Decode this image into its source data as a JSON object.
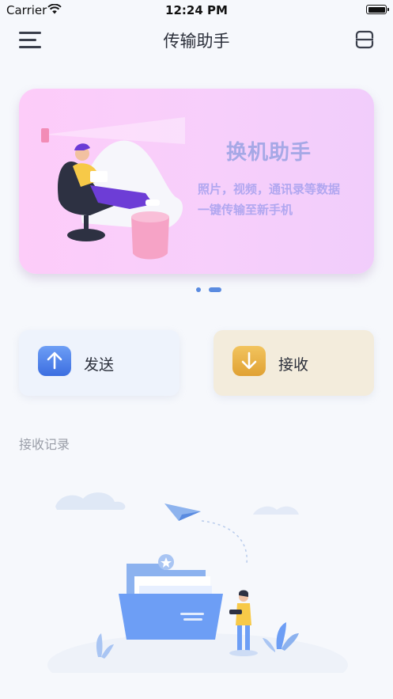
{
  "status_bar": {
    "carrier": "Carrier",
    "time": "12:24 PM"
  },
  "nav": {
    "title": "传输助手",
    "menu_icon": "menu-icon",
    "scan_icon": "scan-icon"
  },
  "banner": {
    "title": "换机助手",
    "line1": "照片，视频，通讯录等数据",
    "line2": "一键传输至新手机",
    "colors": {
      "background": "#fccbf8",
      "title": "#a6a8e6",
      "text": "#b1a7f0"
    }
  },
  "pager": {
    "count": 2,
    "active": 2
  },
  "actions": {
    "send": {
      "label": "发送",
      "icon": "arrow-up-icon",
      "color": "#3c6ee0"
    },
    "receive": {
      "label": "接收",
      "icon": "arrow-down-icon",
      "color": "#e0a133"
    }
  },
  "records": {
    "title": "接收记录",
    "empty_icon": "empty-folder-illustration"
  }
}
